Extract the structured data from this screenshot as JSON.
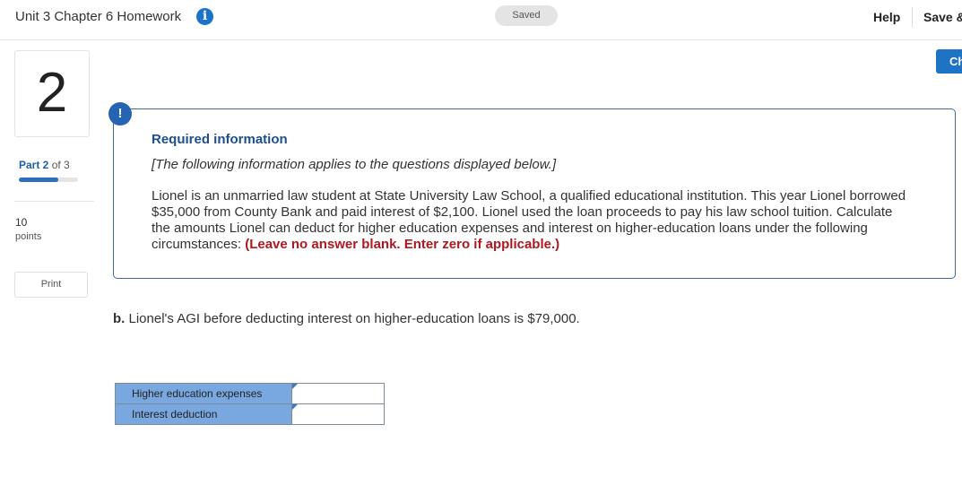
{
  "header": {
    "assignment_title": "Unit 3 Chapter 6 Homework",
    "info_icon": "info-icon",
    "saved_label": "Saved",
    "help_label": "Help",
    "save_exit_label": "Save &",
    "check_label": "Ch"
  },
  "rail": {
    "question_number": "2",
    "part_current": "Part 2",
    "part_of": "of 3",
    "progress_fraction": 0.67,
    "points_value": "10",
    "points_label": "points",
    "print_label": "Print"
  },
  "required": {
    "alert_glyph": "!",
    "title": "Required information",
    "subtitle": "[The following information applies to the questions displayed below.]",
    "body": "Lionel is an unmarried law student at State University Law School, a qualified educational institution. This year Lionel borrowed $35,000 from County Bank and paid interest of $2,100. Lionel used the loan proceeds to pay his law school tuition. Calculate the amounts Lionel can deduct for higher education expenses and interest on higher-education loans under the following circumstances: ",
    "warning": "(Leave no answer blank. Enter zero if applicable.)"
  },
  "question": {
    "part_letter": "b.",
    "text": " Lionel's AGI before deducting interest on higher-education loans is $79,000."
  },
  "answer_table": {
    "rows": [
      {
        "label": "Higher education expenses",
        "value": ""
      },
      {
        "label": "Interest deduction",
        "value": ""
      }
    ]
  },
  "colors": {
    "accent": "#1f73c4",
    "panel_border": "#3f6b9a",
    "warning": "#b0171f",
    "row_label_bg": "#79a8e0"
  }
}
